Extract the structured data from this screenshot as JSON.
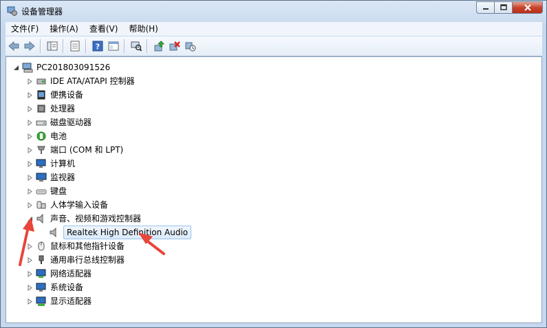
{
  "window": {
    "title": "设备管理器",
    "controls": [
      "minimize",
      "maximize",
      "close"
    ]
  },
  "menu": [
    "文件(F)",
    "操作(A)",
    "查看(V)",
    "帮助(H)"
  ],
  "toolbar": {
    "buttons": [
      "back-icon",
      "forward-icon",
      "tree-view-icon",
      "properties-icon",
      "help-icon",
      "view-icon",
      "scan-icon",
      "update-driver-icon",
      "disable-icon",
      "uninstall-icon"
    ]
  },
  "tree": {
    "root": "PC201803091526",
    "categories": [
      {
        "label": "IDE ATA/ATAPI 控制器",
        "icon": "ide-controller-icon"
      },
      {
        "label": "便携设备",
        "icon": "portable-device-icon"
      },
      {
        "label": "处理器",
        "icon": "processor-icon"
      },
      {
        "label": "磁盘驱动器",
        "icon": "disk-drive-icon"
      },
      {
        "label": "电池",
        "icon": "battery-icon"
      },
      {
        "label": "端口 (COM 和 LPT)",
        "icon": "port-icon"
      },
      {
        "label": "计算机",
        "icon": "computer-icon"
      },
      {
        "label": "监视器",
        "icon": "monitor-icon"
      },
      {
        "label": "键盘",
        "icon": "keyboard-icon"
      },
      {
        "label": "人体学输入设备",
        "icon": "hid-icon"
      },
      {
        "label": "声音、视频和游戏控制器",
        "icon": "speaker-icon",
        "expanded": true,
        "children": [
          "Realtek High Definition Audio"
        ]
      },
      {
        "label": "鼠标和其他指针设备",
        "icon": "mouse-icon"
      },
      {
        "label": "通用串行总线控制器",
        "icon": "usb-icon"
      },
      {
        "label": "网络适配器",
        "icon": "network-icon"
      },
      {
        "label": "系统设备",
        "icon": "system-device-icon"
      },
      {
        "label": "显示适配器",
        "icon": "display-adapter-icon"
      }
    ]
  },
  "annotation_color": "#e8463a"
}
